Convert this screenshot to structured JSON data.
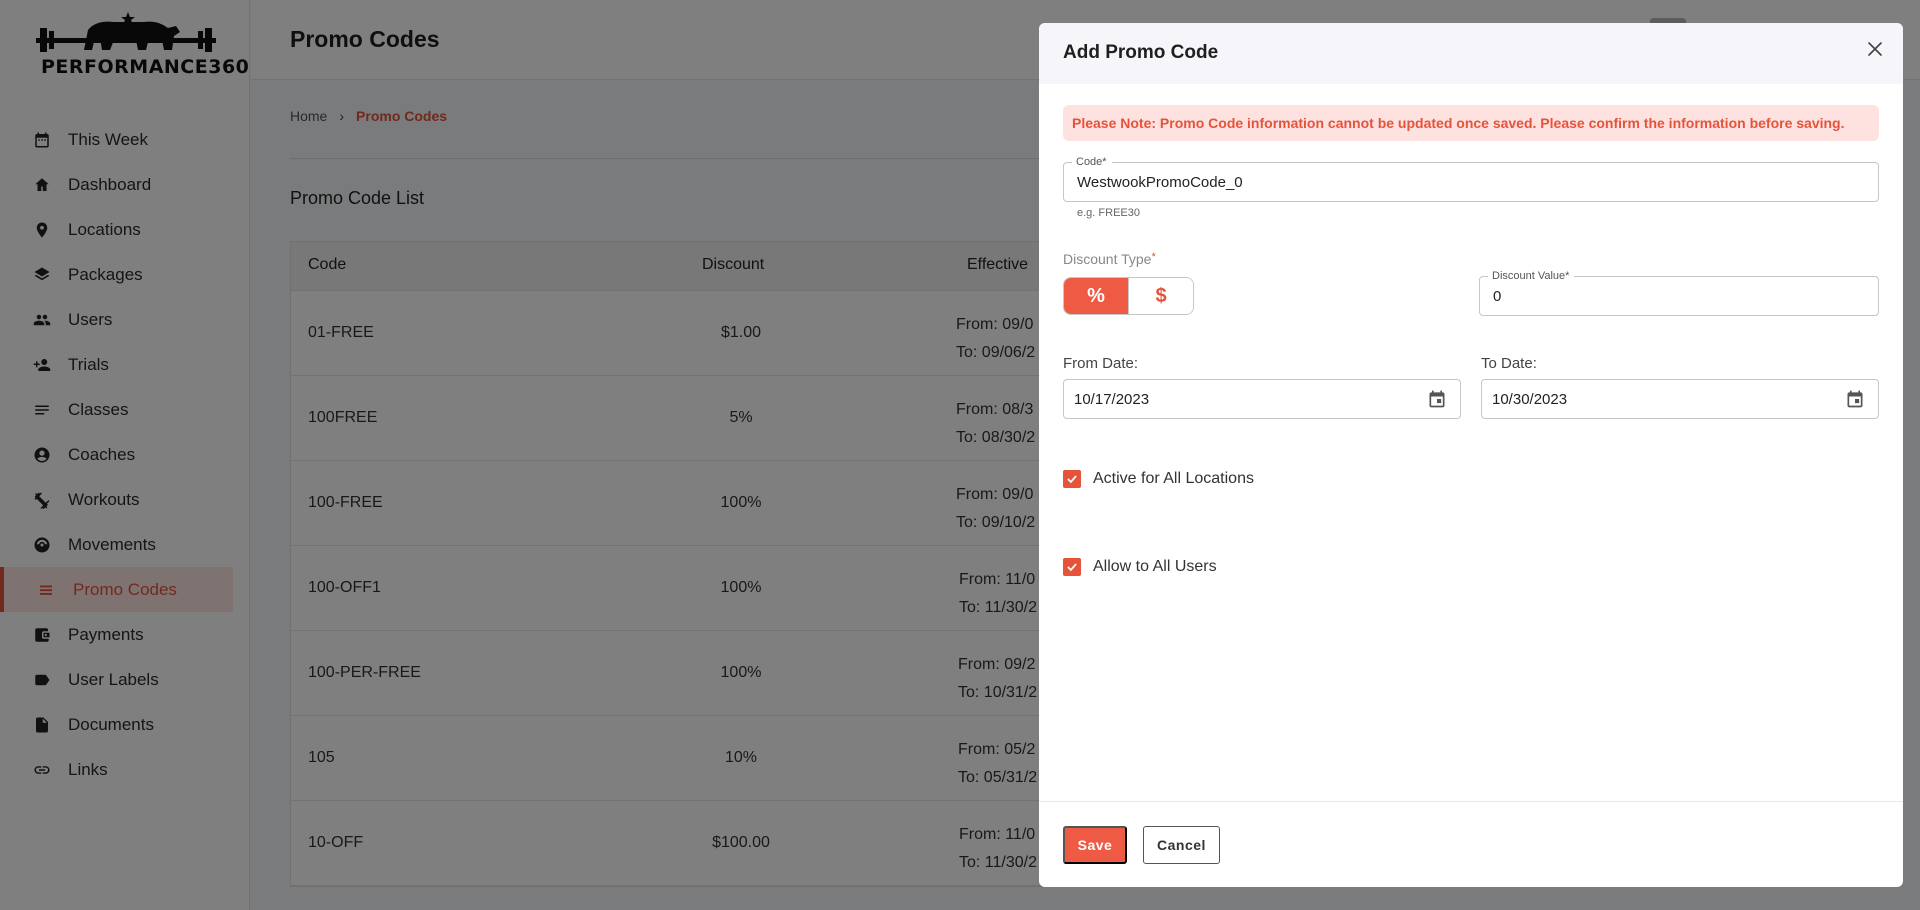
{
  "brand": {
    "logo_text": "PERFORMANCE360"
  },
  "sidebar": {
    "items": [
      {
        "label": "This Week",
        "icon": "calendar-icon"
      },
      {
        "label": "Dashboard",
        "icon": "home-icon"
      },
      {
        "label": "Locations",
        "icon": "location-pin-icon"
      },
      {
        "label": "Packages",
        "icon": "layers-icon"
      },
      {
        "label": "Users",
        "icon": "users-icon"
      },
      {
        "label": "Trials",
        "icon": "person-add-icon"
      },
      {
        "label": "Classes",
        "icon": "lines-icon"
      },
      {
        "label": "Coaches",
        "icon": "account-circle-icon"
      },
      {
        "label": "Workouts",
        "icon": "fitness-icon"
      },
      {
        "label": "Movements",
        "icon": "motion-icon"
      },
      {
        "label": "Promo Codes",
        "icon": "list-icon",
        "active": true
      },
      {
        "label": "Payments",
        "icon": "wallet-icon"
      },
      {
        "label": "User Labels",
        "icon": "label-icon"
      },
      {
        "label": "Documents",
        "icon": "document-icon"
      },
      {
        "label": "Links",
        "icon": "link-icon"
      }
    ]
  },
  "header": {
    "title": "Promo Codes"
  },
  "breadcrumb": {
    "home": "Home",
    "separator": "›",
    "current": "Promo Codes"
  },
  "list": {
    "title": "Promo Code List",
    "columns": {
      "code": "Code",
      "discount": "Discount",
      "effective": "Effective"
    },
    "rows": [
      {
        "code": "01-FREE",
        "discount": "$1.00",
        "from": "From: 09/0",
        "to": "To: 09/06/2"
      },
      {
        "code": "100FREE",
        "discount": "5%",
        "from": "From: 08/3",
        "to": "To: 08/30/2"
      },
      {
        "code": "100-FREE",
        "discount": "100%",
        "from": "From: 09/0",
        "to": "To: 09/10/2"
      },
      {
        "code": "100-OFF1",
        "discount": "100%",
        "from": "From: 11/0",
        "to": "To: 11/30/2"
      },
      {
        "code": "100-PER-FREE",
        "discount": "100%",
        "from": "From: 09/2",
        "to": "To: 10/31/2"
      },
      {
        "code": "105",
        "discount": "10%",
        "from": "From: 05/2",
        "to": "To: 05/31/2"
      },
      {
        "code": "10-OFF",
        "discount": "$100.00",
        "from": "From: 11/0",
        "to": "To: 11/30/2"
      }
    ]
  },
  "modal": {
    "title": "Add Promo Code",
    "alert": "Please Note: Promo Code information cannot be updated once saved. Please confirm the information before saving.",
    "code": {
      "label": "Code",
      "required": "*",
      "value": "WestwookPromoCode_0",
      "helper": "e.g. FREE30"
    },
    "discount_type": {
      "label": "Discount Type",
      "required": "*",
      "options": [
        "%",
        "$"
      ],
      "selected": "%"
    },
    "discount_value": {
      "label": "Discount Value",
      "required": "*",
      "value": "0"
    },
    "from_date": {
      "label": "From Date:",
      "value": "10/17/2023"
    },
    "to_date": {
      "label": "To Date:",
      "value": "10/30/2023"
    },
    "active_all_locations": {
      "label": "Active for All Locations",
      "checked": true
    },
    "allow_all_users": {
      "label": "Allow to All Users",
      "checked": true
    },
    "save_label": "Save",
    "cancel_label": "Cancel"
  },
  "colors": {
    "accent": "#e5533b",
    "overlay": "rgba(0,0,0,0.5)",
    "alert_bg": "#fde2e0"
  }
}
